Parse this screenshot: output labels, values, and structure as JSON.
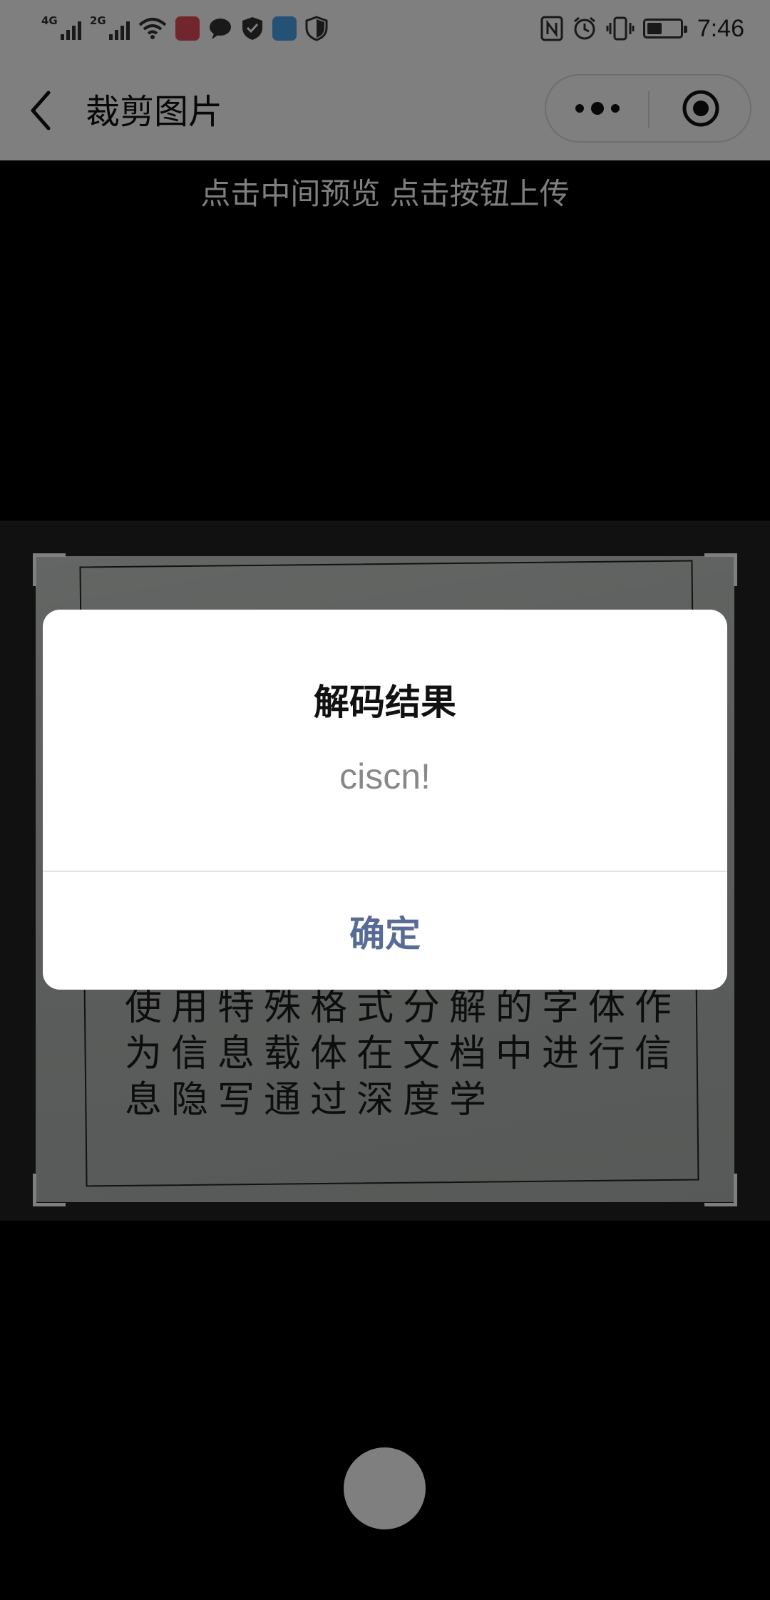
{
  "status_bar": {
    "time": "7:46",
    "network_1": "4G",
    "network_2": "2G",
    "icons": [
      "signal-icon",
      "wifi-icon",
      "book-app-icon",
      "message-icon",
      "shield-icon",
      "browser-app-icon",
      "security-icon",
      "nfc-icon",
      "alarm-icon",
      "vibrate-icon",
      "battery-icon"
    ],
    "battery_level": 0.45
  },
  "nav_bar": {
    "title": "裁剪图片",
    "icons": [
      "back-arrow-icon",
      "more-dots-icon",
      "close-target-icon"
    ]
  },
  "main": {
    "hint": "点击中间预览 点击按钮上传",
    "photo_lines": [
      "使用特殊格式分解的字体作",
      "为信息载体在文档中进行信",
      "息隐写通过深度学"
    ]
  },
  "modal": {
    "title": "解码结果",
    "content": "ciscn!",
    "confirm_label": "确定",
    "confirm_color": "#576b95"
  }
}
